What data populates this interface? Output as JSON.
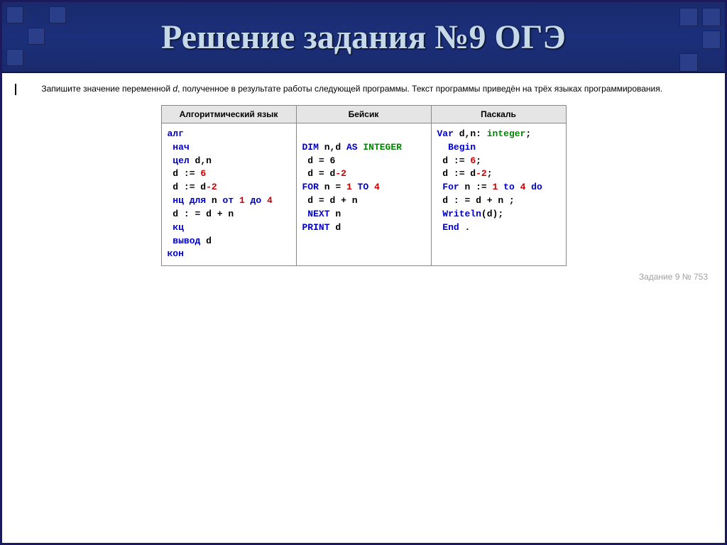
{
  "header": {
    "title": "Решение задания №9 ОГЭ"
  },
  "task": {
    "prompt_part1": "Запишите значение переменной ",
    "prompt_var": "d",
    "prompt_part2": ", полученное в результате работы следующей программы. Текст программы приведён на трёх языках программирования."
  },
  "table": {
    "headers": [
      "Алгоритмический язык",
      "Бейсик",
      "Паскаль"
    ]
  },
  "code": {
    "alg": {
      "l1_kw": "алг",
      "l2_kw": " нач",
      "l3_kw": " цел ",
      "l3_rest": "d,n",
      "l4_a": " d := ",
      "l4_num": "6",
      "l5_a": " d := d",
      "l5_num": "-2",
      "l6_kw": " нц для ",
      "l6_mid": "n ",
      "l6_ot": "от ",
      "l6_n1": "1",
      "l6_do": " до ",
      "l6_n2": "4",
      "l7": " d : = d + n",
      "l8_kw": " кц",
      "l9_kw": " вывод ",
      "l9_rest": "d",
      "l10_kw": "кон"
    },
    "basic": {
      "l1_dim": "DIM ",
      "l1_vars": "n,d ",
      "l1_as": "AS ",
      "l1_type": "INTEGER",
      "l2": " d = 6",
      "l3_a": " d = d",
      "l3_num": "-2",
      "l4_for": "FOR ",
      "l4_mid": "n = ",
      "l4_n1": "1",
      "l4_to": " TO ",
      "l4_n2": "4",
      "l5": " d = d + n",
      "l6_next": " NEXT ",
      "l6_var": "n",
      "l7_print": "PRINT ",
      "l7_var": "d"
    },
    "pascal": {
      "l1_var": "Var ",
      "l1_decl": "d,n: ",
      "l1_type": "integer",
      "l1_semi": ";",
      "l2_begin": "  Begin",
      "l3_a": " d := ",
      "l3_n": "6",
      "l3_semi": ";",
      "l4_a": " d := d",
      "l4_n": "-2",
      "l4_semi": ";",
      "l5_for": " For ",
      "l5_mid": "n := ",
      "l5_n1": "1",
      "l5_to": " to ",
      "l5_n2": "4",
      "l5_do": " do",
      "l6": " d : = d + n ;",
      "l7_w": " Writeln",
      "l7_arg": "(d);",
      "l8_end": " End ",
      "l8_dot": "."
    }
  },
  "footer": {
    "task_id": "Задание 9 № 753"
  }
}
